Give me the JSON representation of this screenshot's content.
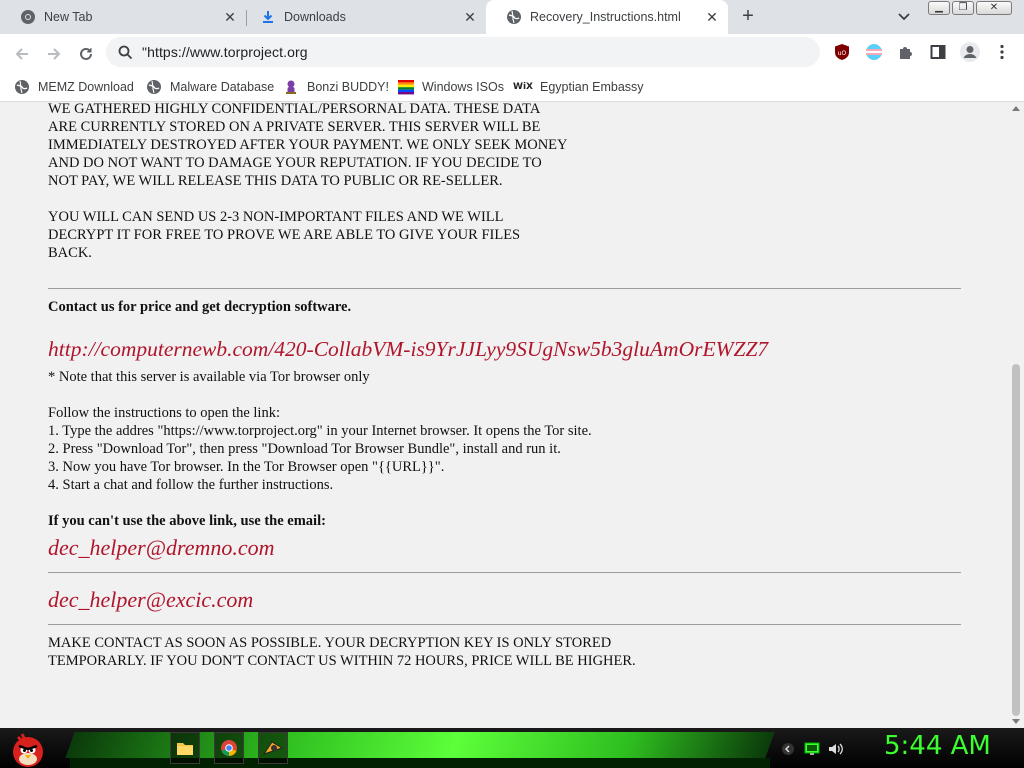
{
  "tabs": [
    {
      "title": "New Tab",
      "icon": "chrome-icon"
    },
    {
      "title": "Downloads",
      "icon": "download-icon"
    },
    {
      "title": "Recovery_Instructions.html",
      "icon": "globe-icon"
    }
  ],
  "toolbar": {
    "url": "\"https://www.torproject.org"
  },
  "bookmarks": [
    {
      "label": "MEMZ Download",
      "icon": "globe-icon"
    },
    {
      "label": "Malware Database",
      "icon": "globe-icon"
    },
    {
      "label": "Bonzi BUDDY!",
      "icon": "bonzi-icon"
    },
    {
      "label": "Windows ISOs",
      "icon": "windows-icon"
    },
    {
      "label": "Egyptian Embassy",
      "icon": "wix-icon"
    }
  ],
  "page": {
    "para1": "WE GATHERED HIGHLY CONFIDENTIAL/PERSORNAL DATA. THESE DATA\nARE CURRENTLY STORED ON A PRIVATE SERVER. THIS SERVER WILL BE\nIMMEDIATELY DESTROYED AFTER YOUR PAYMENT. WE ONLY SEEK MONEY\nAND DO NOT WANT TO DAMAGE YOUR REPUTATION. IF YOU DECIDE TO\nNOT PAY, WE WILL RELEASE THIS DATA TO PUBLIC OR RE-SELLER.",
    "para2": "YOU WILL CAN SEND US 2-3 NON-IMPORTANT FILES AND WE WILL\nDECRYPT IT FOR FREE TO PROVE WE ARE ABLE TO GIVE YOUR FILES\nBACK.",
    "contact_heading": "Contact us for price and get decryption software.",
    "link": "http://computernewb.com/420-CollabVM-is9YrJJLyy9SUgNsw5b3gluAmOrEWZZ7",
    "note": "* Note that this server is available via Tor browser only",
    "instructions": "Follow the instructions to open the link:\n1. Type the addres \"https://www.torproject.org\" in your Internet browser. It opens the Tor site.\n2. Press \"Download Tor\", then press \"Download Tor Browser Bundle\", install and run it.\n3. Now you have Tor browser. In the Tor Browser open \"{{URL}}\".\n4. Start a chat and follow the further instructions.",
    "email_heading": "If you can't use the above link, use the email:",
    "email1": "dec_helper@dremno.com",
    "email2": "dec_helper@excic.com",
    "final": "MAKE CONTACT AS SOON AS POSSIBLE. YOUR DECRYPTION KEY IS ONLY STORED\nTEMPORARLY. IF YOU DON'T CONTACT US WITHIN 72 HOURS, PRICE WILL BE HIGHER."
  },
  "taskbar": {
    "clock": "5:44 AM",
    "apps": [
      "folder-icon",
      "chrome-icon",
      "winamp-icon"
    ]
  },
  "colors": {
    "link_red": "#b0152b",
    "clock_green": "#3cff30",
    "taskbar_glow": "#5cff3a"
  }
}
